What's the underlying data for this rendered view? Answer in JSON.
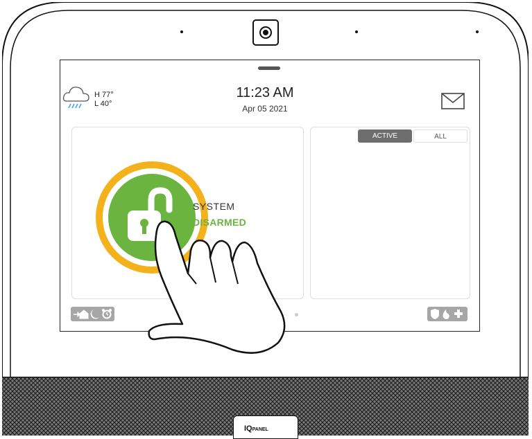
{
  "weather": {
    "icon": "rain-cloud-icon",
    "high": "H 77°",
    "low": "L 40°"
  },
  "clock": {
    "time": "11:23 AM",
    "date": "Apr 05 2021"
  },
  "header": {
    "messages_icon": "envelope-icon"
  },
  "security": {
    "status_line1": "SYSTEM",
    "status_line2": "DISARMED",
    "status_color": "#6ab43f",
    "ring_color": "#f3b21b"
  },
  "sensors_panel": {
    "tabs": [
      {
        "label": "ACTIVE",
        "selected": true
      },
      {
        "label": "ALL",
        "selected": false
      }
    ]
  },
  "left_shortcuts": {
    "icons": [
      "exit-door-icon",
      "moon-icon",
      "alarm-clock-icon"
    ]
  },
  "right_shortcuts": {
    "icons": [
      "shield-icon",
      "fire-icon",
      "medical-cross-icon"
    ]
  },
  "brand": {
    "logo_main": "IQ",
    "logo_sub": "PANEL"
  }
}
